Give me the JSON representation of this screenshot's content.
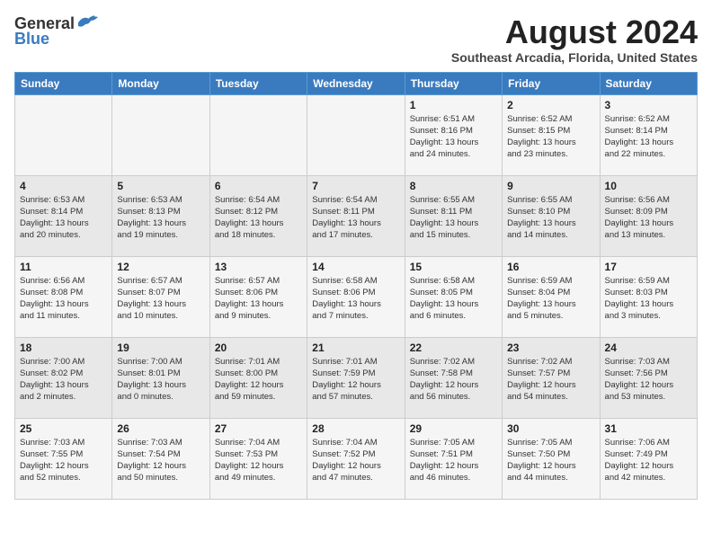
{
  "logo": {
    "general": "General",
    "blue": "Blue"
  },
  "title": {
    "month_year": "August 2024",
    "location": "Southeast Arcadia, Florida, United States"
  },
  "weekdays": [
    "Sunday",
    "Monday",
    "Tuesday",
    "Wednesday",
    "Thursday",
    "Friday",
    "Saturday"
  ],
  "weeks": [
    [
      {
        "day": "",
        "info": ""
      },
      {
        "day": "",
        "info": ""
      },
      {
        "day": "",
        "info": ""
      },
      {
        "day": "",
        "info": ""
      },
      {
        "day": "1",
        "info": "Sunrise: 6:51 AM\nSunset: 8:16 PM\nDaylight: 13 hours\nand 24 minutes."
      },
      {
        "day": "2",
        "info": "Sunrise: 6:52 AM\nSunset: 8:15 PM\nDaylight: 13 hours\nand 23 minutes."
      },
      {
        "day": "3",
        "info": "Sunrise: 6:52 AM\nSunset: 8:14 PM\nDaylight: 13 hours\nand 22 minutes."
      }
    ],
    [
      {
        "day": "4",
        "info": "Sunrise: 6:53 AM\nSunset: 8:14 PM\nDaylight: 13 hours\nand 20 minutes."
      },
      {
        "day": "5",
        "info": "Sunrise: 6:53 AM\nSunset: 8:13 PM\nDaylight: 13 hours\nand 19 minutes."
      },
      {
        "day": "6",
        "info": "Sunrise: 6:54 AM\nSunset: 8:12 PM\nDaylight: 13 hours\nand 18 minutes."
      },
      {
        "day": "7",
        "info": "Sunrise: 6:54 AM\nSunset: 8:11 PM\nDaylight: 13 hours\nand 17 minutes."
      },
      {
        "day": "8",
        "info": "Sunrise: 6:55 AM\nSunset: 8:11 PM\nDaylight: 13 hours\nand 15 minutes."
      },
      {
        "day": "9",
        "info": "Sunrise: 6:55 AM\nSunset: 8:10 PM\nDaylight: 13 hours\nand 14 minutes."
      },
      {
        "day": "10",
        "info": "Sunrise: 6:56 AM\nSunset: 8:09 PM\nDaylight: 13 hours\nand 13 minutes."
      }
    ],
    [
      {
        "day": "11",
        "info": "Sunrise: 6:56 AM\nSunset: 8:08 PM\nDaylight: 13 hours\nand 11 minutes."
      },
      {
        "day": "12",
        "info": "Sunrise: 6:57 AM\nSunset: 8:07 PM\nDaylight: 13 hours\nand 10 minutes."
      },
      {
        "day": "13",
        "info": "Sunrise: 6:57 AM\nSunset: 8:06 PM\nDaylight: 13 hours\nand 9 minutes."
      },
      {
        "day": "14",
        "info": "Sunrise: 6:58 AM\nSunset: 8:06 PM\nDaylight: 13 hours\nand 7 minutes."
      },
      {
        "day": "15",
        "info": "Sunrise: 6:58 AM\nSunset: 8:05 PM\nDaylight: 13 hours\nand 6 minutes."
      },
      {
        "day": "16",
        "info": "Sunrise: 6:59 AM\nSunset: 8:04 PM\nDaylight: 13 hours\nand 5 minutes."
      },
      {
        "day": "17",
        "info": "Sunrise: 6:59 AM\nSunset: 8:03 PM\nDaylight: 13 hours\nand 3 minutes."
      }
    ],
    [
      {
        "day": "18",
        "info": "Sunrise: 7:00 AM\nSunset: 8:02 PM\nDaylight: 13 hours\nand 2 minutes."
      },
      {
        "day": "19",
        "info": "Sunrise: 7:00 AM\nSunset: 8:01 PM\nDaylight: 13 hours\nand 0 minutes."
      },
      {
        "day": "20",
        "info": "Sunrise: 7:01 AM\nSunset: 8:00 PM\nDaylight: 12 hours\nand 59 minutes."
      },
      {
        "day": "21",
        "info": "Sunrise: 7:01 AM\nSunset: 7:59 PM\nDaylight: 12 hours\nand 57 minutes."
      },
      {
        "day": "22",
        "info": "Sunrise: 7:02 AM\nSunset: 7:58 PM\nDaylight: 12 hours\nand 56 minutes."
      },
      {
        "day": "23",
        "info": "Sunrise: 7:02 AM\nSunset: 7:57 PM\nDaylight: 12 hours\nand 54 minutes."
      },
      {
        "day": "24",
        "info": "Sunrise: 7:03 AM\nSunset: 7:56 PM\nDaylight: 12 hours\nand 53 minutes."
      }
    ],
    [
      {
        "day": "25",
        "info": "Sunrise: 7:03 AM\nSunset: 7:55 PM\nDaylight: 12 hours\nand 52 minutes."
      },
      {
        "day": "26",
        "info": "Sunrise: 7:03 AM\nSunset: 7:54 PM\nDaylight: 12 hours\nand 50 minutes."
      },
      {
        "day": "27",
        "info": "Sunrise: 7:04 AM\nSunset: 7:53 PM\nDaylight: 12 hours\nand 49 minutes."
      },
      {
        "day": "28",
        "info": "Sunrise: 7:04 AM\nSunset: 7:52 PM\nDaylight: 12 hours\nand 47 minutes."
      },
      {
        "day": "29",
        "info": "Sunrise: 7:05 AM\nSunset: 7:51 PM\nDaylight: 12 hours\nand 46 minutes."
      },
      {
        "day": "30",
        "info": "Sunrise: 7:05 AM\nSunset: 7:50 PM\nDaylight: 12 hours\nand 44 minutes."
      },
      {
        "day": "31",
        "info": "Sunrise: 7:06 AM\nSunset: 7:49 PM\nDaylight: 12 hours\nand 42 minutes."
      }
    ]
  ]
}
